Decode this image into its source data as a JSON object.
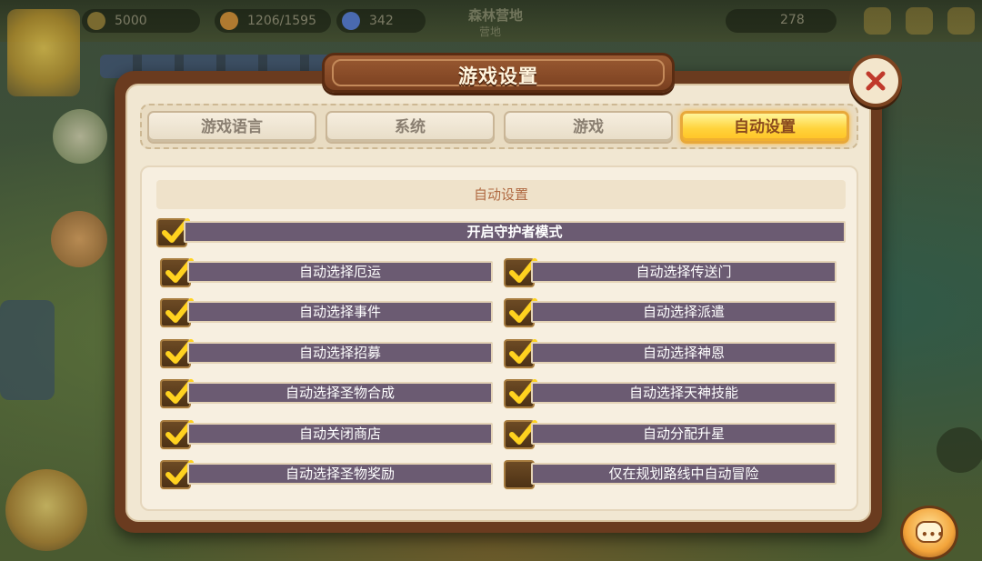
{
  "hud": {
    "gold": "5000",
    "capacity": "1206/1595",
    "gems": "342",
    "location_title": "森林营地",
    "location_sub": "营地",
    "right_value": "278"
  },
  "dialog": {
    "title": "游戏设置",
    "tabs": [
      {
        "label": "游戏语言",
        "active": false
      },
      {
        "label": "系统",
        "active": false
      },
      {
        "label": "游戏",
        "active": false
      },
      {
        "label": "自动设置",
        "active": true
      }
    ],
    "section_title": "自动设置",
    "guardian": {
      "label": "开启守护者模式",
      "checked": true
    },
    "options_left": [
      {
        "label": "自动选择厄运",
        "checked": true
      },
      {
        "label": "自动选择事件",
        "checked": true
      },
      {
        "label": "自动选择招募",
        "checked": true
      },
      {
        "label": "自动选择圣物合成",
        "checked": true
      },
      {
        "label": "自动关闭商店",
        "checked": true
      },
      {
        "label": "自动选择圣物奖励",
        "checked": true
      }
    ],
    "options_right": [
      {
        "label": "自动选择传送门",
        "checked": true
      },
      {
        "label": "自动选择派遣",
        "checked": true
      },
      {
        "label": "自动选择神恩",
        "checked": true
      },
      {
        "label": "自动选择天神技能",
        "checked": true
      },
      {
        "label": "自动分配升星",
        "checked": true
      },
      {
        "label": "仅在规划路线中自动冒险",
        "checked": false
      }
    ]
  },
  "colors": {
    "frame": "#6a3b1f",
    "panel": "#f1e7d2",
    "option_bar": "#6b5b72",
    "tab_active": "#ffd33b",
    "check": "#ffd21f"
  },
  "icons": {
    "close": "close-icon",
    "chat": "chat-bubble-icon",
    "check": "checkmark-icon"
  }
}
